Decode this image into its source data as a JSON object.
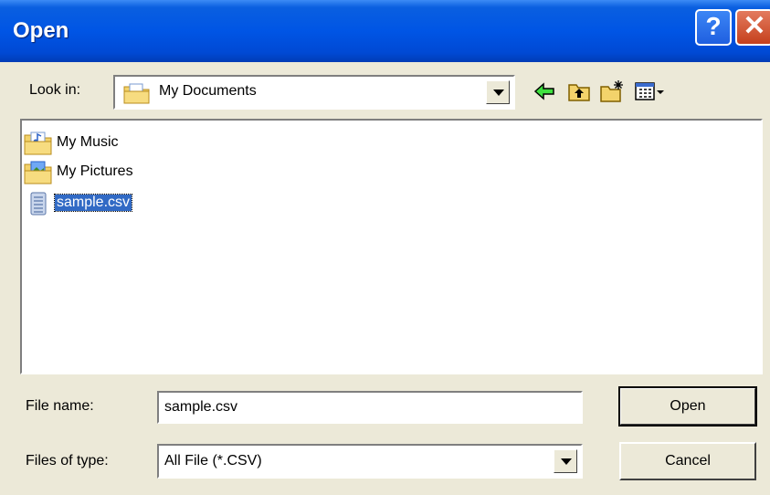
{
  "window": {
    "title": "Open",
    "help_label": "?",
    "close_label": "✕"
  },
  "lookin": {
    "label": "Look in:",
    "value": "My Documents"
  },
  "toolbar": {
    "icons": [
      "back-icon",
      "up-folder-icon",
      "new-folder-icon",
      "view-menu-icon"
    ]
  },
  "files": [
    {
      "name": "My Music",
      "icon": "music-folder-icon"
    },
    {
      "name": "My Pictures",
      "icon": "pictures-folder-icon"
    },
    {
      "name": "sample.csv",
      "icon": "csv-file-icon",
      "selected": true
    }
  ],
  "filename": {
    "label": "File name:",
    "value": "sample.csv"
  },
  "filetype": {
    "label": "Files of type:",
    "value": "All File (*.CSV)"
  },
  "buttons": {
    "open": "Open",
    "cancel": "Cancel"
  },
  "colors": {
    "titlebar": "#0055E5",
    "dialog": "#ECE9D8",
    "selection": "#316AC5"
  }
}
